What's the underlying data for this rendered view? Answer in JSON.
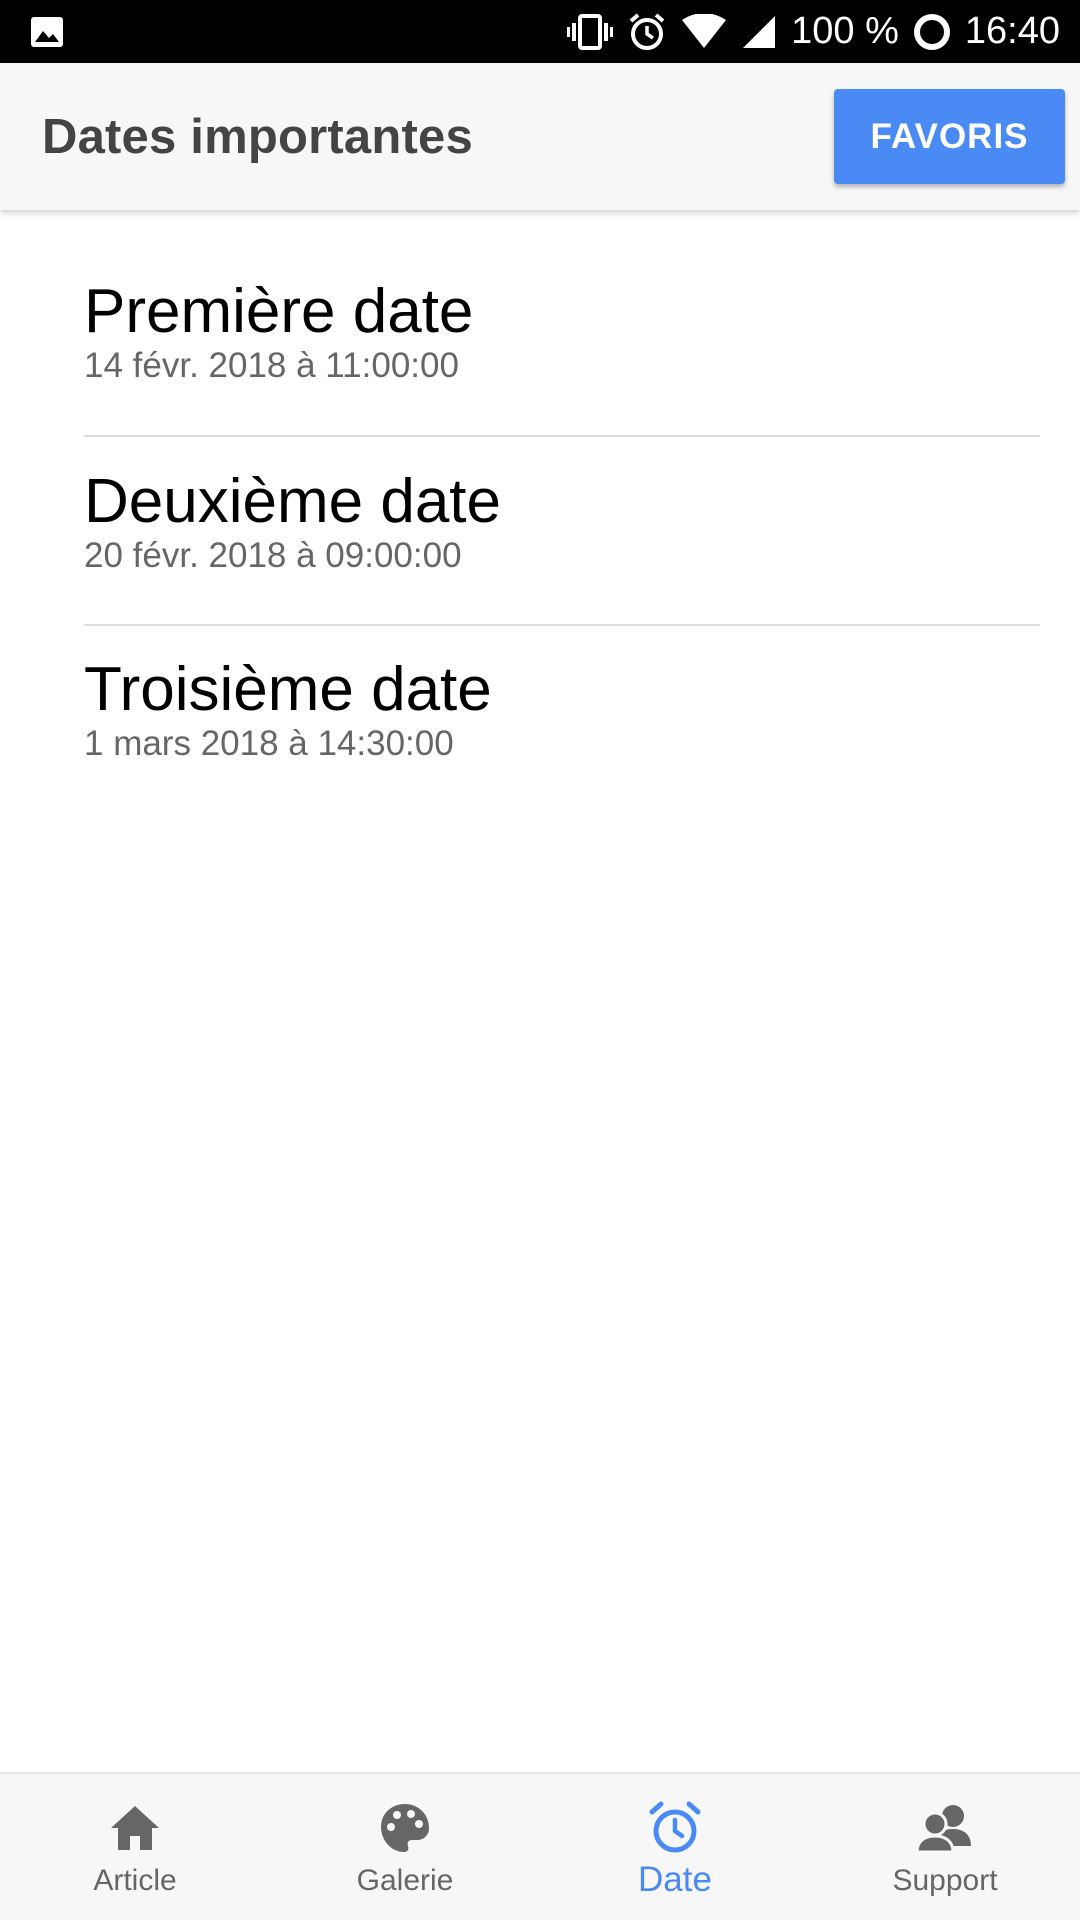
{
  "status_bar": {
    "battery": "100 %",
    "time": "16:40",
    "icons": [
      "image-icon",
      "vibrate-icon",
      "alarm-icon",
      "wifi-icon",
      "signal-icon",
      "battery-ring-icon"
    ]
  },
  "app_bar": {
    "title": "Dates importantes",
    "favoris_label": "FAVORIS"
  },
  "dates": [
    {
      "title": "Première date",
      "subtitle": "14 févr. 2018 à 11:00:00"
    },
    {
      "title": "Deuxième date",
      "subtitle": "20 févr. 2018 à 09:00:00"
    },
    {
      "title": "Troisième date",
      "subtitle": "1 mars 2018 à 14:30:00"
    }
  ],
  "bottom_nav": {
    "items": [
      {
        "label": "Article",
        "icon": "home-icon",
        "active": false
      },
      {
        "label": "Galerie",
        "icon": "palette-icon",
        "active": false
      },
      {
        "label": "Date",
        "icon": "alarm-clock-icon",
        "active": true
      },
      {
        "label": "Support",
        "icon": "support-icon",
        "active": false
      }
    ]
  },
  "colors": {
    "accent": "#4a8af4",
    "app_bar_bg": "#f7f7f7",
    "inactive_icon": "#666666"
  }
}
